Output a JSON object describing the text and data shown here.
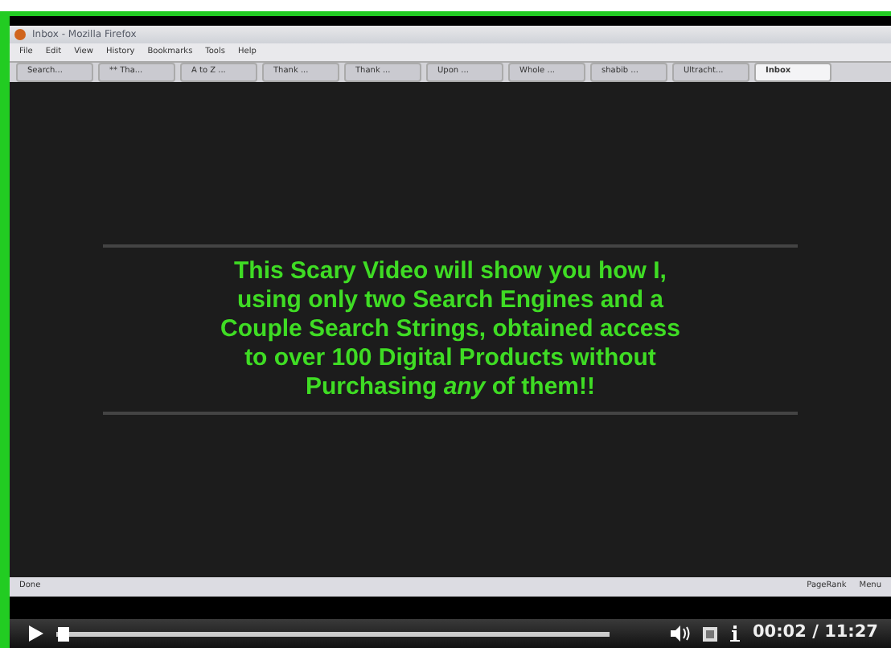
{
  "browser": {
    "title": "Inbox - Mozilla Firefox",
    "menu": [
      "File",
      "Edit",
      "View",
      "History",
      "Bookmarks",
      "Tools",
      "Help"
    ],
    "tabs": [
      {
        "label": "Search...",
        "selected": false
      },
      {
        "label": "** Tha...",
        "selected": false
      },
      {
        "label": "A to Z ...",
        "selected": false
      },
      {
        "label": "Thank ...",
        "selected": false
      },
      {
        "label": "Thank ...",
        "selected": false
      },
      {
        "label": "Upon ...",
        "selected": false
      },
      {
        "label": "Whole ...",
        "selected": false
      },
      {
        "label": "shabib ...",
        "selected": false
      },
      {
        "label": "Ultracht...",
        "selected": false
      },
      {
        "label": "Inbox",
        "selected": true
      }
    ],
    "status": "Done",
    "status_right": [
      "PageRank",
      "Menu"
    ]
  },
  "message": "This Scary Video will show you how I, using only two Search Engines and a Couple Search Strings, obtained access to over 100 Digital Products without Purchasing *any* of them!!",
  "player": {
    "level": 0.003,
    "time": "00:02 / 11:27"
  }
}
